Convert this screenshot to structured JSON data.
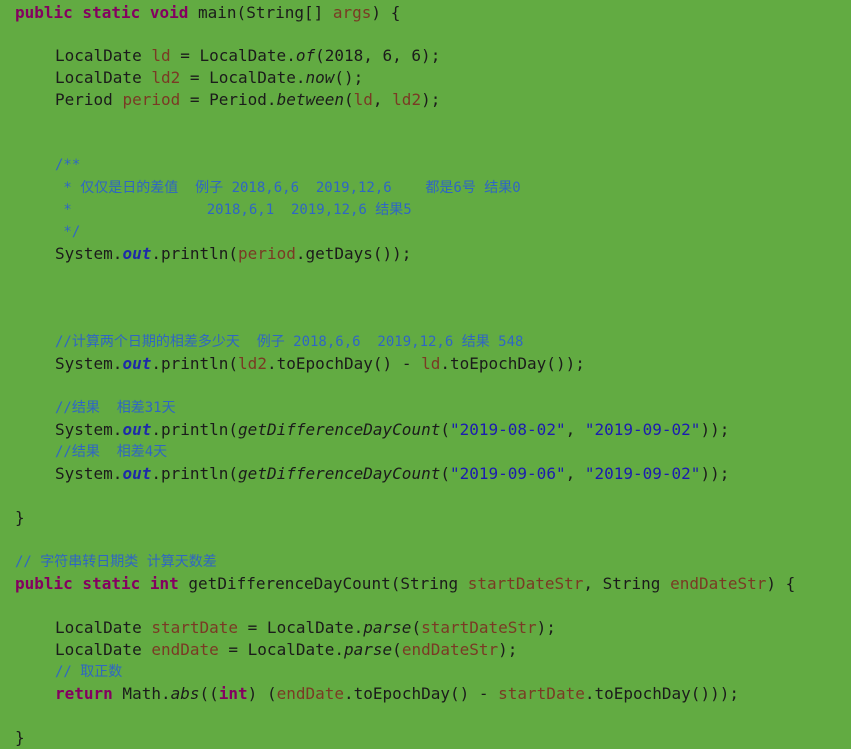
{
  "code": {
    "main_decl": {
      "kw": "public static void",
      "name": " main(String[] ",
      "param": "args",
      "close": ") {"
    },
    "ld": {
      "type": "LocalDate ",
      "var": "ld",
      "eq": " = LocalDate.",
      "method": "of",
      "args": "(2018, 6, 6);"
    },
    "ld2": {
      "type": "LocalDate ",
      "var": "ld2",
      "eq": " = LocalDate.",
      "method": "now",
      "args": "();"
    },
    "period": {
      "type": "Period ",
      "var": "period",
      "eq": " = Period.",
      "method": "between",
      "open": "(",
      "arg1": "ld",
      "sep": ", ",
      "arg2": "ld2",
      "close": ");"
    },
    "doc": [
      "/**",
      " * 仅仅是日的差值  例子 2018,6,6  2019,12,6    都是6号 结果0",
      " *                2018,6,1  2019,12,6 结果5",
      " */"
    ],
    "print_days": {
      "prefix": "System.",
      "out": "out",
      "mid": ".println(",
      "var": "period",
      "rest": ".getDays());"
    },
    "comment_diff": "//计算两个日期的相差多少天  例子 2018,6,6  2019,12,6 结果 548",
    "print_epoch": {
      "prefix": "System.",
      "out": "out",
      "mid": ".println(",
      "v1": "ld2",
      "mid2": ".toEpochDay() - ",
      "v2": "ld",
      "rest": ".toEpochDay());"
    },
    "comment_r1": "//结果  相差31天",
    "print_c1": {
      "prefix": "System.",
      "out": "out",
      "mid": ".println(",
      "method": "getDifferenceDayCount",
      "open": "(",
      "a1": "\"2019-08-02\"",
      "sep": ", ",
      "a2": "\"2019-09-02\"",
      "close": "));"
    },
    "comment_r2": "//结果  相差4天",
    "print_c2": {
      "prefix": "System.",
      "out": "out",
      "mid": ".println(",
      "method": "getDifferenceDayCount",
      "open": "(",
      "a1": "\"2019-09-06\"",
      "sep": ", ",
      "a2": "\"2019-09-02\"",
      "close": "));"
    },
    "close_main": "}",
    "comment_conv": "// 字符串转日期类 计算天数差",
    "method_decl": {
      "kw1": "public static",
      "sp": " ",
      "kw2": "int",
      "name": " getDifferenceDayCount(String ",
      "p1": "startDateStr",
      "mid": ", String ",
      "p2": "endDateStr",
      "close": ") {"
    },
    "start_date": {
      "type": "LocalDate ",
      "var": "startDate",
      "eq": " = LocalDate.",
      "method": "parse",
      "open": "(",
      "arg": "startDateStr",
      "close": ");"
    },
    "end_date": {
      "type": "LocalDate ",
      "var": "endDate",
      "eq": " = LocalDate.",
      "method": "parse",
      "open": "(",
      "arg": "endDateStr",
      "close": ");"
    },
    "comment_abs": "// 取正数",
    "return_line": {
      "kw": "return",
      "pre": " Math.",
      "method": "abs",
      "p1": "((",
      "cast": "int",
      "p2": ") (",
      "v1": "endDate",
      "mid": ".toEpochDay() - ",
      "v2": "startDate",
      "close": ".toEpochDay()));"
    },
    "close_method": "}"
  },
  "colors": {
    "background": "#62ab42",
    "keyword": "#840060",
    "variable": "#7a3a24",
    "comment": "#2f66c4",
    "string": "#1c1cb0",
    "field": "#1e2ba8"
  }
}
